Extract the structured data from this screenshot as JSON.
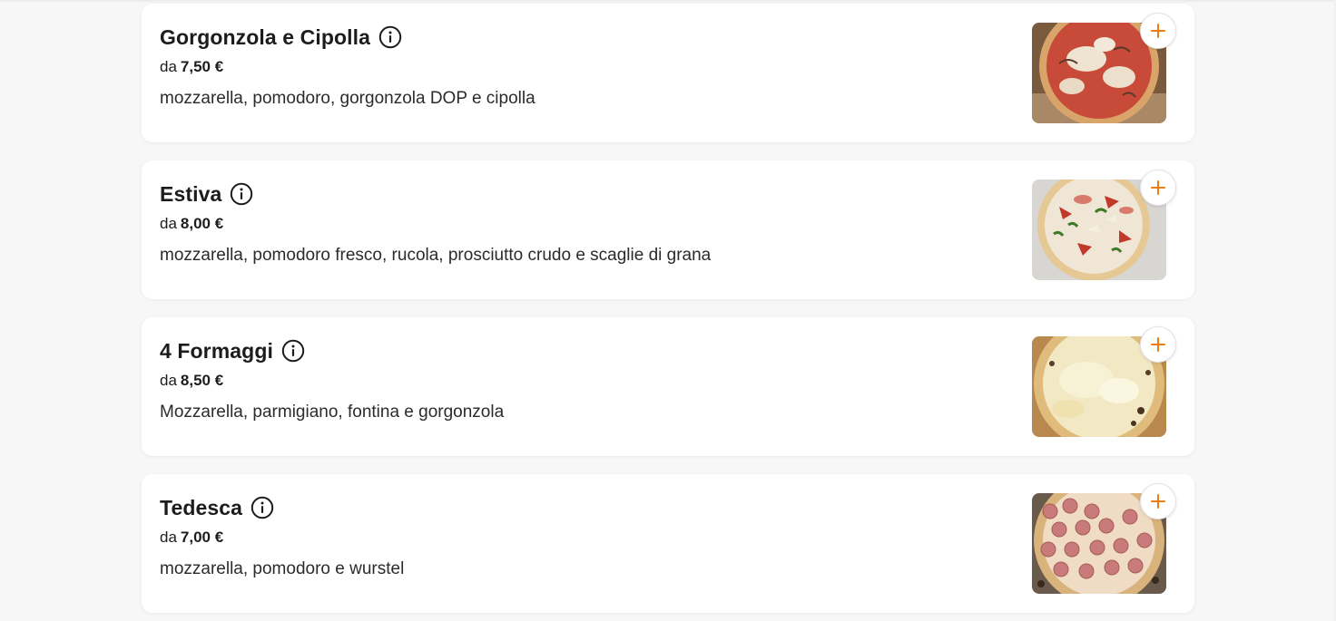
{
  "menu": {
    "accent_color": "#f07b0f",
    "items": [
      {
        "name": "Gorgonzola e Cipolla",
        "price_prefix": "da",
        "price": "7,50 €",
        "description": "mozzarella, pomodoro, gorgonzola DOP e cipolla",
        "info_icon": "info-icon",
        "add_icon": "plus-icon"
      },
      {
        "name": "Estiva",
        "price_prefix": "da",
        "price": "8,00 €",
        "description": "mozzarella, pomodoro fresco, rucola, prosciutto crudo e scaglie di grana",
        "info_icon": "info-icon",
        "add_icon": "plus-icon"
      },
      {
        "name": "4 Formaggi",
        "price_prefix": "da",
        "price": "8,50 €",
        "description": "Mozzarella, parmigiano, fontina e gorgonzola",
        "info_icon": "info-icon",
        "add_icon": "plus-icon"
      },
      {
        "name": "Tedesca",
        "price_prefix": "da",
        "price": "7,00 €",
        "description": "mozzarella, pomodoro e wurstel",
        "info_icon": "info-icon",
        "add_icon": "plus-icon"
      }
    ]
  }
}
